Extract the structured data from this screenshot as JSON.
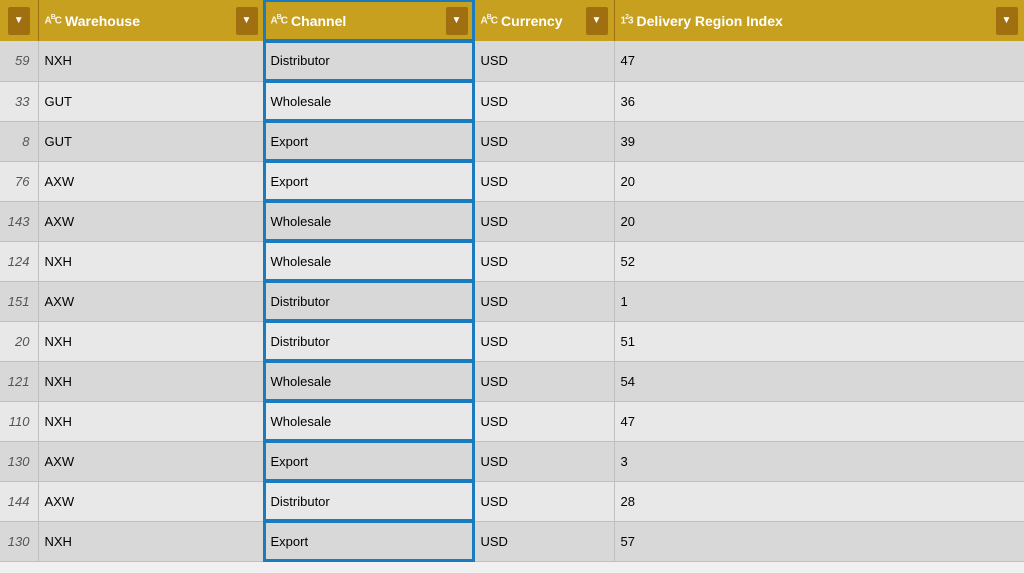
{
  "columns": {
    "index": {
      "icon": "≡",
      "dropdown": true
    },
    "warehouse": {
      "label": "Warehouse",
      "icon": "ABC",
      "dropdown": true
    },
    "channel": {
      "label": "Channel",
      "icon": "ABC",
      "dropdown": true
    },
    "currency": {
      "label": "Currency",
      "icon": "ABC",
      "dropdown": true
    },
    "delivery": {
      "label": "Delivery Region Index",
      "icon": "123",
      "dropdown": true
    }
  },
  "rows": [
    {
      "index": 59,
      "warehouse": "NXH",
      "channel": "Distributor",
      "currency": "USD",
      "delivery": 47
    },
    {
      "index": 33,
      "warehouse": "GUT",
      "channel": "Wholesale",
      "currency": "USD",
      "delivery": 36
    },
    {
      "index": 8,
      "warehouse": "GUT",
      "channel": "Export",
      "currency": "USD",
      "delivery": 39
    },
    {
      "index": 76,
      "warehouse": "AXW",
      "channel": "Export",
      "currency": "USD",
      "delivery": 20
    },
    {
      "index": 143,
      "warehouse": "AXW",
      "channel": "Wholesale",
      "currency": "USD",
      "delivery": 20
    },
    {
      "index": 124,
      "warehouse": "NXH",
      "channel": "Wholesale",
      "currency": "USD",
      "delivery": 52
    },
    {
      "index": 151,
      "warehouse": "AXW",
      "channel": "Distributor",
      "currency": "USD",
      "delivery": 1
    },
    {
      "index": 20,
      "warehouse": "NXH",
      "channel": "Distributor",
      "currency": "USD",
      "delivery": 51
    },
    {
      "index": 121,
      "warehouse": "NXH",
      "channel": "Wholesale",
      "currency": "USD",
      "delivery": 54
    },
    {
      "index": 110,
      "warehouse": "NXH",
      "channel": "Wholesale",
      "currency": "USD",
      "delivery": 47
    },
    {
      "index": 130,
      "warehouse": "AXW",
      "channel": "Export",
      "currency": "USD",
      "delivery": 3
    },
    {
      "index": 144,
      "warehouse": "AXW",
      "channel": "Distributor",
      "currency": "USD",
      "delivery": 28
    },
    {
      "index": 130,
      "warehouse": "NXH",
      "channel": "Export",
      "currency": "USD",
      "delivery": 57
    }
  ]
}
